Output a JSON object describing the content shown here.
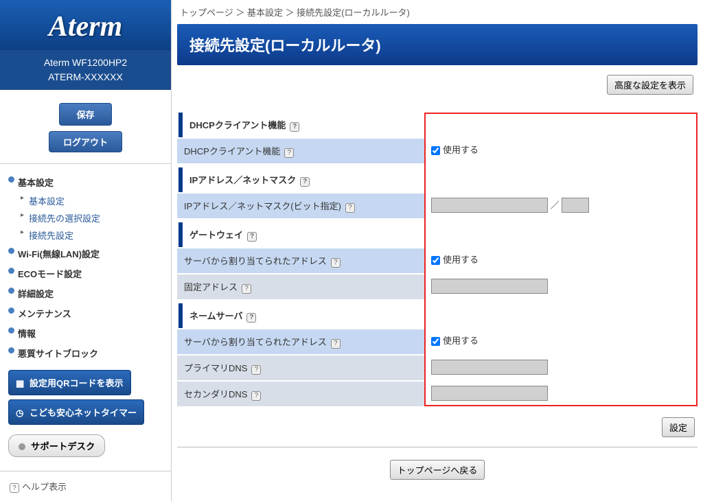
{
  "logo": "Aterm",
  "model": {
    "name": "Aterm WF1200HP2",
    "id": "ATERM-XXXXXX"
  },
  "buttons": {
    "save": "保存",
    "logout": "ログアウト",
    "advanced": "高度な設定を表示",
    "apply": "設定",
    "back_top": "トップページへ戻る"
  },
  "sidebar": {
    "basic": "基本設定",
    "basic_sub1": "基本設定",
    "basic_sub2": "接続先の選択設定",
    "basic_sub3": "接続先設定",
    "wifi": "Wi-Fi(無線LAN)設定",
    "eco": "ECOモード設定",
    "detail": "詳細設定",
    "maint": "メンテナンス",
    "info": "情報",
    "siteblock": "悪質サイトブロック",
    "qr_btn": "設定用QRコードを表示",
    "kids_btn": "こども安心ネットタイマー",
    "support": "サポートデスク",
    "help": "ヘルプ表示"
  },
  "breadcrumb": "トップページ ＞ 基本設定 ＞ 接続先設定(ローカルルータ)",
  "page_title": "接続先設定(ローカルルータ)",
  "sections": {
    "dhcp_head": "DHCPクライアント機能",
    "dhcp_func": "DHCPクライアント機能",
    "ip_head": "IPアドレス／ネットマスク",
    "ip_mask": "IPアドレス／ネットマスク(ビット指定)",
    "gw_head": "ゲートウェイ",
    "gw_server": "サーバから割り当てられたアドレス",
    "gw_fixed": "固定アドレス",
    "ns_head": "ネームサーバ",
    "ns_server": "サーバから割り当てられたアドレス",
    "ns_primary": "プライマリDNS",
    "ns_secondary": "セカンダリDNS"
  },
  "values": {
    "use": "使用する",
    "slash": "／"
  }
}
